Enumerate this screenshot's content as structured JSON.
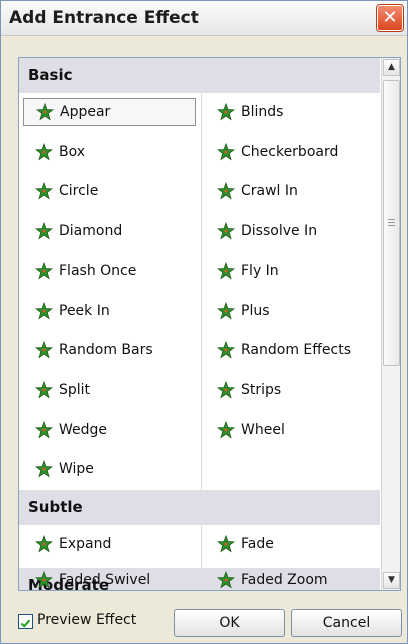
{
  "dialog": {
    "title": "Add Entrance Effect",
    "close_label": "✕"
  },
  "sections": {
    "basic": "Basic",
    "subtle": "Subtle",
    "moderate": "Moderate"
  },
  "basic_items": [
    {
      "label": "Appear",
      "icon": "appear-star-icon",
      "selected": true
    },
    {
      "label": "Blinds",
      "icon": "blinds-star-icon"
    },
    {
      "label": "Box",
      "icon": "box-star-icon"
    },
    {
      "label": "Checkerboard",
      "icon": "checkerboard-star-icon"
    },
    {
      "label": "Circle",
      "icon": "circle-star-icon"
    },
    {
      "label": "Crawl In",
      "icon": "crawl-in-star-icon"
    },
    {
      "label": "Diamond",
      "icon": "diamond-star-icon"
    },
    {
      "label": "Dissolve In",
      "icon": "dissolve-in-star-icon"
    },
    {
      "label": "Flash Once",
      "icon": "flash-once-star-icon"
    },
    {
      "label": "Fly In",
      "icon": "fly-in-star-icon"
    },
    {
      "label": "Peek In",
      "icon": "peek-in-star-icon"
    },
    {
      "label": "Plus",
      "icon": "plus-star-icon"
    },
    {
      "label": "Random Bars",
      "icon": "random-bars-star-icon"
    },
    {
      "label": "Random Effects",
      "icon": "random-effects-star-icon"
    },
    {
      "label": "Split",
      "icon": "split-star-icon"
    },
    {
      "label": "Strips",
      "icon": "strips-star-icon"
    },
    {
      "label": "Wedge",
      "icon": "wedge-star-icon"
    },
    {
      "label": "Wheel",
      "icon": "wheel-star-icon"
    },
    {
      "label": "Wipe",
      "icon": "wipe-star-icon"
    }
  ],
  "subtle_items": [
    {
      "label": "Expand",
      "icon": "expand-star-icon"
    },
    {
      "label": "Fade",
      "icon": "fade-star-icon"
    },
    {
      "label": "Faded Swivel",
      "icon": "faded-swivel-star-icon"
    },
    {
      "label": "Faded Zoom",
      "icon": "faded-zoom-star-icon"
    }
  ],
  "footer": {
    "preview_label": "Preview Effect",
    "preview_checked": true,
    "ok_label": "OK",
    "cancel_label": "Cancel"
  },
  "colors": {
    "star_green": "#2f8f2a",
    "star_dark": "#1e5e1b",
    "accent_orange": "#e2582d"
  }
}
